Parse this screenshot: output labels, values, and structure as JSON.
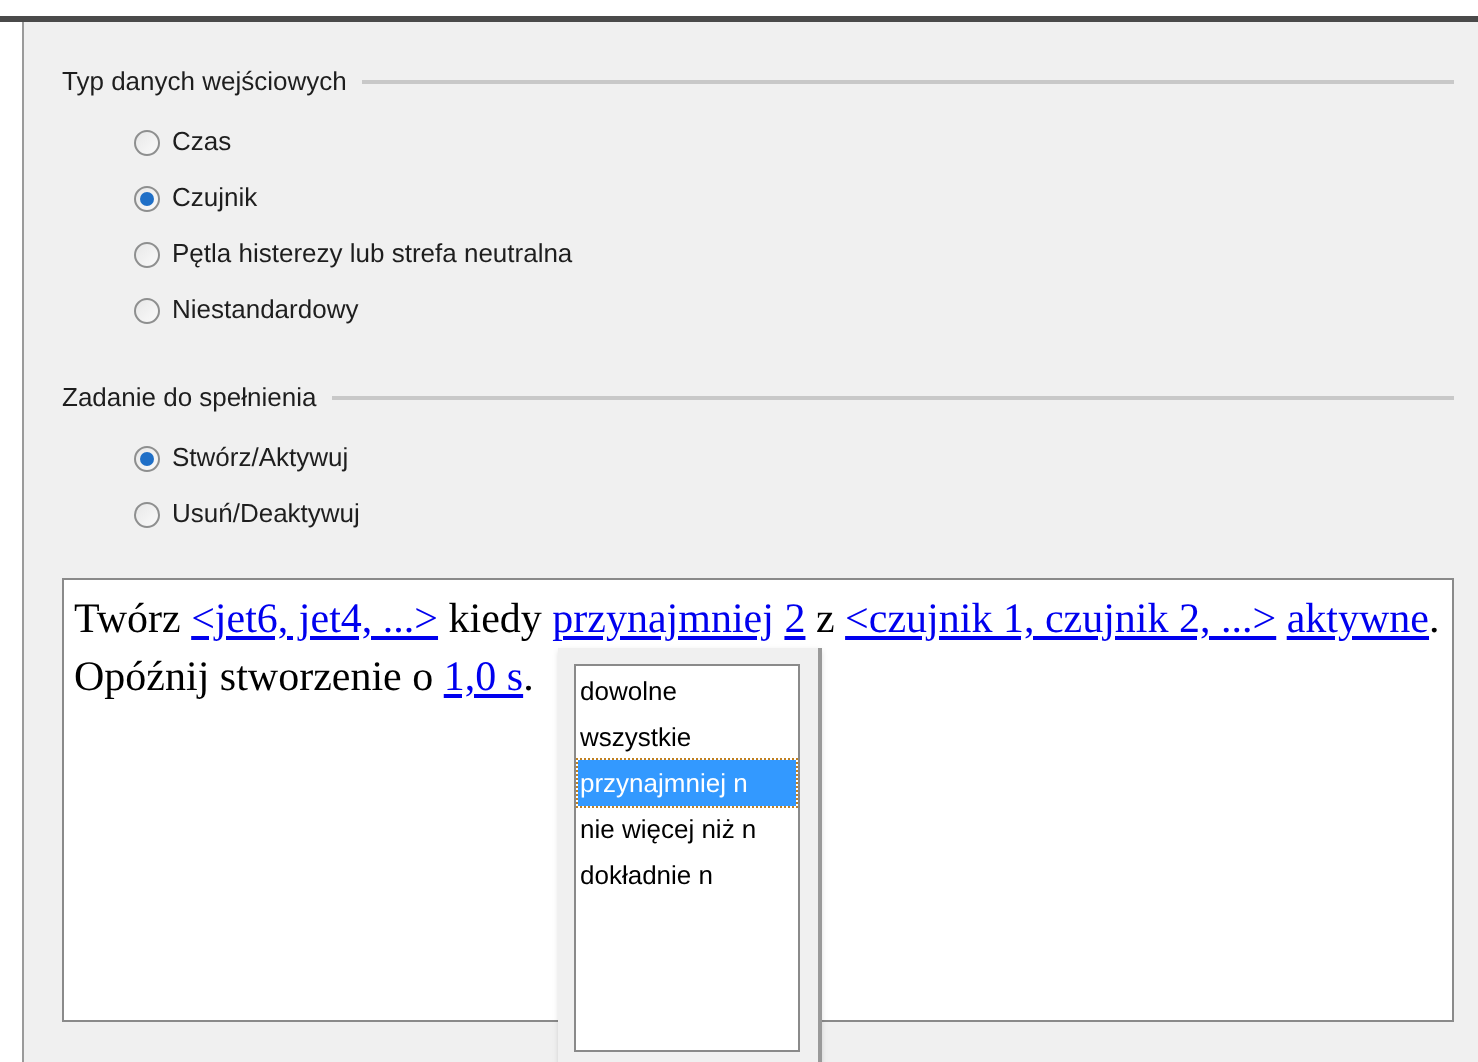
{
  "groups": [
    {
      "title": "Typ danych wejściowych",
      "options": [
        {
          "label": "Czas",
          "selected": false
        },
        {
          "label": "Czujnik",
          "selected": true
        },
        {
          "label": "Pętla histerezy lub strefa neutralna",
          "selected": false
        },
        {
          "label": "Niestandardowy",
          "selected": false
        }
      ]
    },
    {
      "title": "Zadanie do spełnienia",
      "options": [
        {
          "label": "Stwórz/Aktywuj",
          "selected": true
        },
        {
          "label": "Usuń/Deaktywuj",
          "selected": false
        }
      ]
    }
  ],
  "rule": {
    "lines": [
      [
        {
          "kind": "text",
          "text": "Twórz "
        },
        {
          "kind": "link",
          "text": "<jet6, jet4, ...>"
        },
        {
          "kind": "text",
          "text": " kiedy "
        },
        {
          "kind": "link",
          "text": "przynajmniej",
          "space_after": true
        },
        {
          "kind": "link",
          "text": "2"
        },
        {
          "kind": "text",
          "text": " z "
        },
        {
          "kind": "link",
          "text": "<czujnik 1, czujnik 2, ...>",
          "space_after": true
        },
        {
          "kind": "link",
          "text": "aktywne"
        },
        {
          "kind": "text",
          "text": "."
        }
      ],
      [
        {
          "kind": "text",
          "text": "Opóźnij stworzenie o "
        },
        {
          "kind": "link",
          "text": "1,0 s"
        },
        {
          "kind": "text",
          "text": "."
        }
      ]
    ]
  },
  "popup": {
    "items": [
      {
        "label": "dowolne",
        "selected": false
      },
      {
        "label": "wszystkie",
        "selected": false
      },
      {
        "label": "przynajmniej n",
        "selected": true
      },
      {
        "label": "nie więcej niż n",
        "selected": false
      },
      {
        "label": "dokładnie n",
        "selected": false
      }
    ]
  }
}
